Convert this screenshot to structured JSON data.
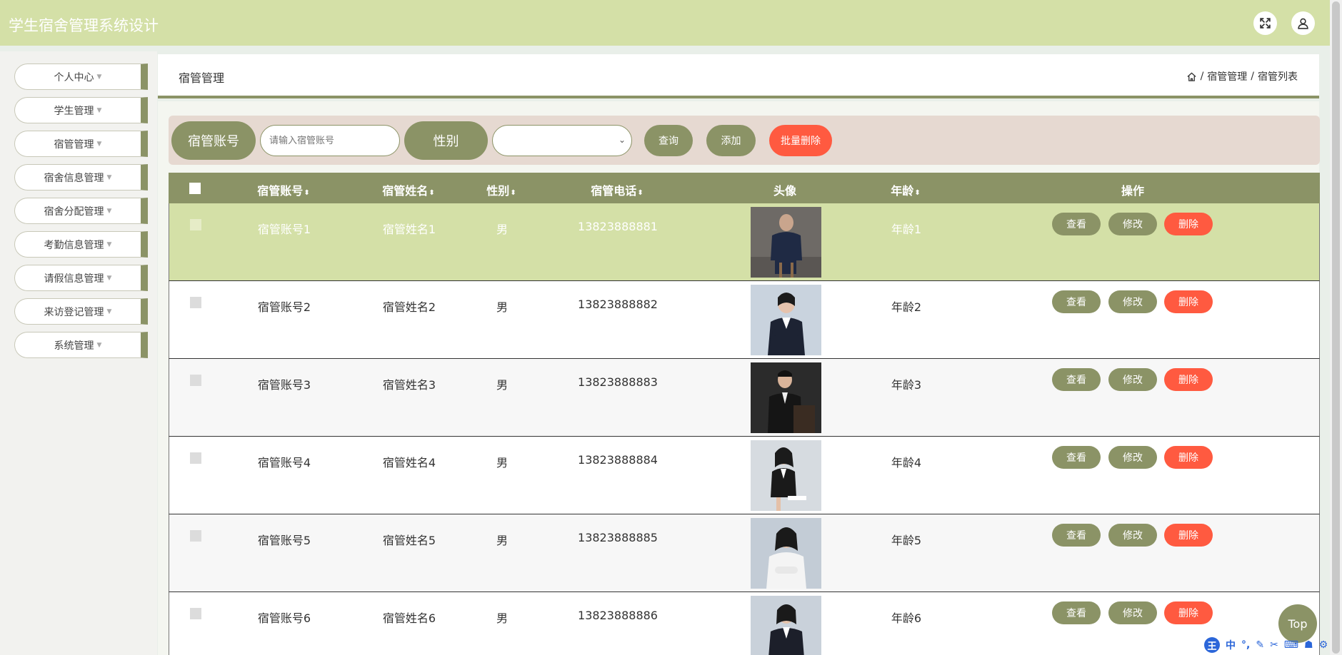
{
  "app": {
    "title": "学生宿舍管理系统设计"
  },
  "sidebar": {
    "items": [
      {
        "label": "个人中心"
      },
      {
        "label": "学生管理"
      },
      {
        "label": "宿管管理"
      },
      {
        "label": "宿舍信息管理"
      },
      {
        "label": "宿舍分配管理"
      },
      {
        "label": "考勤信息管理"
      },
      {
        "label": "请假信息管理"
      },
      {
        "label": "来访登记管理"
      },
      {
        "label": "系统管理"
      }
    ]
  },
  "panel": {
    "title": "宿管管理"
  },
  "breadcrumb": {
    "items": [
      "宿管管理",
      "宿管列表"
    ],
    "separator": "/"
  },
  "search": {
    "account_label": "宿管账号",
    "account_placeholder": "请输入宿管账号",
    "gender_label": "性别",
    "gender_value": "",
    "query_button": "查询",
    "add_button": "添加",
    "batch_delete_button": "批量删除"
  },
  "table": {
    "columns": [
      "宿管账号",
      "宿管姓名",
      "性别",
      "宿管电话",
      "头像",
      "年龄",
      "操作"
    ],
    "sort_icon": "⬍",
    "rows": [
      {
        "account": "宿管账号1",
        "name": "宿管姓名1",
        "gender": "男",
        "phone": "13823888881",
        "age": "年龄1",
        "avatar": "man-in-suit-sitting"
      },
      {
        "account": "宿管账号2",
        "name": "宿管姓名2",
        "gender": "男",
        "phone": "13823888882",
        "age": "年龄2",
        "avatar": "woman-arms-crossed"
      },
      {
        "account": "宿管账号3",
        "name": "宿管姓名3",
        "gender": "男",
        "phone": "13823888883",
        "age": "年龄3",
        "avatar": "man-in-dark-suit"
      },
      {
        "account": "宿管账号4",
        "name": "宿管姓名4",
        "gender": "男",
        "phone": "13823888884",
        "age": "年龄4",
        "avatar": "woman-sitting"
      },
      {
        "account": "宿管账号5",
        "name": "宿管姓名5",
        "gender": "男",
        "phone": "13823888885",
        "age": "年龄5",
        "avatar": "woman-white-shirt"
      },
      {
        "account": "宿管账号6",
        "name": "宿管姓名6",
        "gender": "男",
        "phone": "13823888886",
        "age": "年龄6",
        "avatar": "woman-in-suit"
      }
    ],
    "actions": {
      "view": "查看",
      "edit": "修改",
      "delete": "删除"
    }
  },
  "top_button": "Top",
  "ime": {
    "logo": "王",
    "mode": "中"
  },
  "colors": {
    "header": "#d4e0a7",
    "accent": "#8b9366",
    "danger": "#ff5a40",
    "search_bg": "#e6d9d1",
    "row_highlight": "#d4e0a7"
  }
}
